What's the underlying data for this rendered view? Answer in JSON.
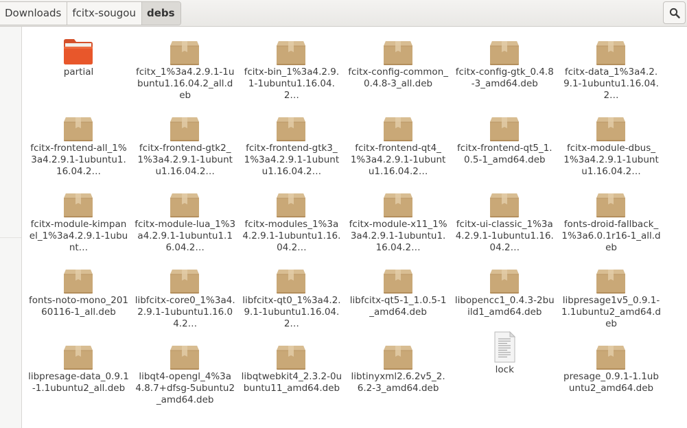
{
  "breadcrumb": {
    "items": [
      {
        "label": "Downloads"
      },
      {
        "label": "fcitx-sougou"
      },
      {
        "label": "debs"
      }
    ]
  },
  "search": {
    "icon": "search-icon"
  },
  "files": [
    {
      "name": "partial",
      "type": "folder"
    },
    {
      "name": "fcitx_1%3a4.2.9.1-1ubuntu1.16.04.2_all.deb",
      "type": "package"
    },
    {
      "name": "fcitx-bin_1%3a4.2.9.1-1ubuntu1.16.04.2…",
      "type": "package"
    },
    {
      "name": "fcitx-config-common_0.4.8-3_all.deb",
      "type": "package"
    },
    {
      "name": "fcitx-config-gtk_0.4.8-3_amd64.deb",
      "type": "package"
    },
    {
      "name": "fcitx-data_1%3a4.2.9.1-1ubuntu1.16.04.2…",
      "type": "package"
    },
    {
      "name": "fcitx-frontend-all_1%3a4.2.9.1-1ubuntu1.16.04.2…",
      "type": "package"
    },
    {
      "name": "fcitx-frontend-gtk2_1%3a4.2.9.1-1ubuntu1.16.04.2…",
      "type": "package"
    },
    {
      "name": "fcitx-frontend-gtk3_1%3a4.2.9.1-1ubuntu1.16.04.2…",
      "type": "package"
    },
    {
      "name": "fcitx-frontend-qt4_1%3a4.2.9.1-1ubuntu1.16.04.2…",
      "type": "package"
    },
    {
      "name": "fcitx-frontend-qt5_1.0.5-1_amd64.deb",
      "type": "package"
    },
    {
      "name": "fcitx-module-dbus_1%3a4.2.9.1-1ubuntu1.16.04.2…",
      "type": "package"
    },
    {
      "name": "fcitx-module-kimpanel_1%3a4.2.9.1-1ubunt…",
      "type": "package"
    },
    {
      "name": "fcitx-module-lua_1%3a4.2.9.1-1ubuntu1.16.04.2…",
      "type": "package"
    },
    {
      "name": "fcitx-modules_1%3a4.2.9.1-1ubuntu1.16.04.2…",
      "type": "package"
    },
    {
      "name": "fcitx-module-x11_1%3a4.2.9.1-1ubuntu1.16.04.2…",
      "type": "package"
    },
    {
      "name": "fcitx-ui-classic_1%3a4.2.9.1-1ubuntu1.16.04.2…",
      "type": "package"
    },
    {
      "name": "fonts-droid-fallback_1%3a6.0.1r16-1_all.deb",
      "type": "package"
    },
    {
      "name": "fonts-noto-mono_20160116-1_all.deb",
      "type": "package"
    },
    {
      "name": "libfcitx-core0_1%3a4.2.9.1-1ubuntu1.16.04.2…",
      "type": "package"
    },
    {
      "name": "libfcitx-qt0_1%3a4.2.9.1-1ubuntu1.16.04.2…",
      "type": "package"
    },
    {
      "name": "libfcitx-qt5-1_1.0.5-1_amd64.deb",
      "type": "package"
    },
    {
      "name": "libopencc1_0.4.3-2build1_amd64.deb",
      "type": "package"
    },
    {
      "name": "libpresage1v5_0.9.1-1.1ubuntu2_amd64.deb",
      "type": "package"
    },
    {
      "name": "libpresage-data_0.9.1-1.1ubuntu2_all.deb",
      "type": "package"
    },
    {
      "name": "libqt4-opengl_4%3a4.8.7+dfsg-5ubuntu2_amd64.deb",
      "type": "package"
    },
    {
      "name": "libqtwebkit4_2.3.2-0ubuntu11_amd64.deb",
      "type": "package"
    },
    {
      "name": "libtinyxml2.6.2v5_2.6.2-3_amd64.deb",
      "type": "package"
    },
    {
      "name": "lock",
      "type": "text"
    },
    {
      "name": "presage_0.9.1-1.1ubuntu2_amd64.deb",
      "type": "package"
    }
  ],
  "colors": {
    "folder": "#e8572b",
    "folder_tab": "#d4502a",
    "package": "#c9a877",
    "package_dark": "#b38e5c",
    "text": "#3c3c3c"
  }
}
